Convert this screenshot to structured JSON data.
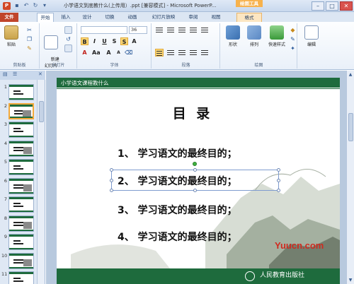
{
  "window": {
    "title": "小学语文到底教什么(上传用）.ppt [兼容模式] - Microsoft PowerP...",
    "contextual_label": "绘图工具"
  },
  "tabs": [
    "文件",
    "开始",
    "插入",
    "设计",
    "切换",
    "动画",
    "幻灯片放映",
    "审阅",
    "视图",
    "格式"
  ],
  "ribbon": {
    "clipboard": {
      "paste": "粘贴",
      "label": "剪贴板"
    },
    "slides": {
      "new_slide": "新建\n幻灯片",
      "label": "幻灯片"
    },
    "font": {
      "size": "36",
      "label": "字体"
    },
    "paragraph": {
      "label": "段落"
    },
    "drawing": {
      "shapes": "形状",
      "arrange": "排列",
      "quick_styles": "快速样式",
      "label": "绘图"
    },
    "editing": {
      "edit": "编辑"
    }
  },
  "slide_thumbnails": [
    "1",
    "2",
    "3",
    "4",
    "5",
    "6",
    "7",
    "8",
    "9",
    "10",
    "11"
  ],
  "selected_slide": "2",
  "slide": {
    "header_tag": "小学语文课程教什么",
    "title": "目  录",
    "items": [
      "1、 学习语文的最终目的；",
      "2、 学习语文的最终目的；",
      "3、 学习语文的最终目的；",
      "4、 学习语文的最终目的；"
    ],
    "publisher": "人民教育出版社"
  },
  "watermark": "Yuucn.com",
  "colors": {
    "slide_green": "#1e6b3d",
    "file_tab": "#c0452b",
    "ribbon_highlight": "#fbd775"
  }
}
